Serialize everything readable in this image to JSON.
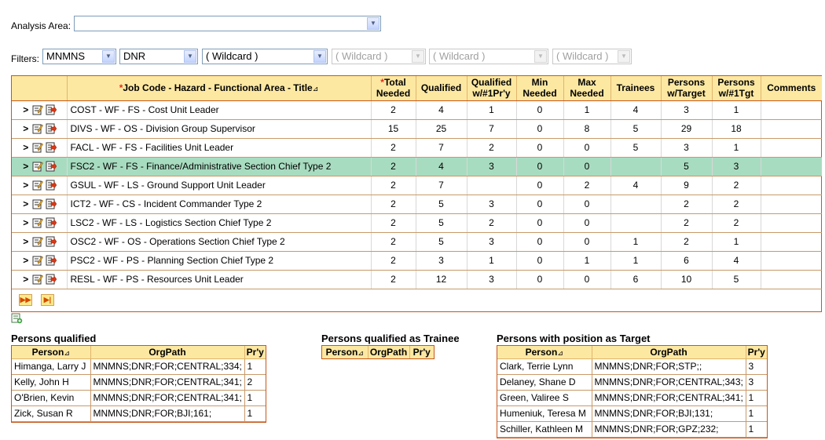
{
  "analysis_area": {
    "label": "Analysis Area:",
    "value": ""
  },
  "filters": {
    "label": "Filters:",
    "selects": [
      {
        "value": "MNMNS",
        "disabled": false
      },
      {
        "value": "DNR",
        "disabled": false
      },
      {
        "value": "( Wildcard )",
        "disabled": false
      },
      {
        "value": "( Wildcard )",
        "disabled": true
      },
      {
        "value": "( Wildcard )",
        "disabled": true
      },
      {
        "value": "( Wildcard )",
        "disabled": true
      }
    ]
  },
  "grid": {
    "headers": {
      "job_required_mark": "*",
      "job": "Job Code - Hazard - Functional Area - Title",
      "sort_mark": "⊿",
      "total_required_mark": "*",
      "total": "Total Needed",
      "qualified": "Qualified",
      "qualified_pry": "Qualified w/#1Pr'y",
      "min": "Min Needed",
      "max": "Max Needed",
      "trainees": "Trainees",
      "persons_target": "Persons w/Target",
      "persons_tgt": "Persons w/#1Tgt",
      "comments": "Comments"
    },
    "rows": [
      {
        "title": "COST - WF - FS - Cost Unit Leader",
        "total": "2",
        "qualified": "4",
        "qualified_pry": "1",
        "min": "0",
        "max": "1",
        "trainees": "4",
        "persons_target": "3",
        "persons_tgt": "1",
        "comments": ""
      },
      {
        "title": "DIVS - WF - OS - Division Group Supervisor",
        "total": "15",
        "qualified": "25",
        "qualified_pry": "7",
        "min": "0",
        "max": "8",
        "trainees": "5",
        "persons_target": "29",
        "persons_tgt": "18",
        "comments": ""
      },
      {
        "title": "FACL - WF - FS - Facilities Unit Leader",
        "total": "2",
        "qualified": "7",
        "qualified_pry": "2",
        "min": "0",
        "max": "0",
        "trainees": "5",
        "persons_target": "3",
        "persons_tgt": "1",
        "comments": ""
      },
      {
        "title": "FSC2 - WF - FS - Finance/Administrative Section Chief Type 2",
        "total": "2",
        "qualified": "4",
        "qualified_pry": "3",
        "min": "0",
        "max": "0",
        "trainees": "",
        "persons_target": "5",
        "persons_tgt": "3",
        "comments": "",
        "selected": true
      },
      {
        "title": "GSUL - WF - LS - Ground Support Unit Leader",
        "total": "2",
        "qualified": "7",
        "qualified_pry": "",
        "min": "0",
        "max": "2",
        "trainees": "4",
        "persons_target": "9",
        "persons_tgt": "2",
        "comments": ""
      },
      {
        "title": "ICT2 - WF - CS - Incident Commander Type 2",
        "total": "2",
        "qualified": "5",
        "qualified_pry": "3",
        "min": "0",
        "max": "0",
        "trainees": "",
        "persons_target": "2",
        "persons_tgt": "2",
        "comments": ""
      },
      {
        "title": "LSC2 - WF - LS - Logistics Section Chief Type 2",
        "total": "2",
        "qualified": "5",
        "qualified_pry": "2",
        "min": "0",
        "max": "0",
        "trainees": "",
        "persons_target": "2",
        "persons_tgt": "2",
        "comments": ""
      },
      {
        "title": "OSC2 - WF - OS - Operations Section Chief Type 2",
        "total": "2",
        "qualified": "5",
        "qualified_pry": "3",
        "min": "0",
        "max": "0",
        "trainees": "1",
        "persons_target": "2",
        "persons_tgt": "1",
        "comments": ""
      },
      {
        "title": "PSC2 - WF - PS - Planning Section Chief Type 2",
        "total": "2",
        "qualified": "3",
        "qualified_pry": "1",
        "min": "0",
        "max": "1",
        "trainees": "1",
        "persons_target": "6",
        "persons_tgt": "4",
        "comments": ""
      },
      {
        "title": "RESL - WF - PS - Resources Unit Leader",
        "total": "2",
        "qualified": "12",
        "qualified_pry": "3",
        "min": "0",
        "max": "0",
        "trainees": "6",
        "persons_target": "10",
        "persons_tgt": "5",
        "comments": ""
      }
    ],
    "row_icons": [
      "expand-chevron-icon",
      "edit-icon",
      "details-icon"
    ]
  },
  "persons_qualified": {
    "title": "Persons qualified",
    "headers": {
      "person": "Person",
      "sort_mark": "⊿",
      "orgpath": "OrgPath",
      "pry": "Pr'y"
    },
    "rows": [
      {
        "person": "Himanga, Larry J",
        "orgpath": "MNMNS;DNR;FOR;CENTRAL;334;",
        "pry": "1"
      },
      {
        "person": "Kelly, John H",
        "orgpath": "MNMNS;DNR;FOR;CENTRAL;341;",
        "pry": "2"
      },
      {
        "person": "O'Brien, Kevin",
        "orgpath": "MNMNS;DNR;FOR;CENTRAL;341;",
        "pry": "1"
      },
      {
        "person": "Zick, Susan R",
        "orgpath": "MNMNS;DNR;FOR;BJI;161;",
        "pry": "1"
      }
    ]
  },
  "persons_trainee": {
    "title": "Persons qualified as Trainee",
    "headers": {
      "person": "Person",
      "sort_mark": "⊿",
      "orgpath": "OrgPath",
      "pry": "Pr'y"
    }
  },
  "persons_target": {
    "title": "Persons with position as Target",
    "headers": {
      "person": "Person",
      "sort_mark": "⊿",
      "orgpath": "OrgPath",
      "pry": "Pr'y"
    },
    "rows": [
      {
        "person": "Clark, Terrie Lynn",
        "orgpath": "MNMNS;DNR;FOR;STP;;",
        "pry": "3"
      },
      {
        "person": "Delaney, Shane D",
        "orgpath": "MNMNS;DNR;FOR;CENTRAL;343;",
        "pry": "3"
      },
      {
        "person": "Green, Valiree S",
        "orgpath": "MNMNS;DNR;FOR;CENTRAL;341;",
        "pry": "1"
      },
      {
        "person": "Humeniuk, Teresa M",
        "orgpath": "MNMNS;DNR;FOR;BJI;131;",
        "pry": "1"
      },
      {
        "person": "Schiller, Kathleen M",
        "orgpath": "MNMNS;DNR;FOR;GPZ;232;",
        "pry": "1"
      }
    ]
  },
  "colors": {
    "header_bg": "#fde8a2",
    "border": "#c7561b",
    "selected_row": "#a8dcc0",
    "required": "#e0301e"
  }
}
